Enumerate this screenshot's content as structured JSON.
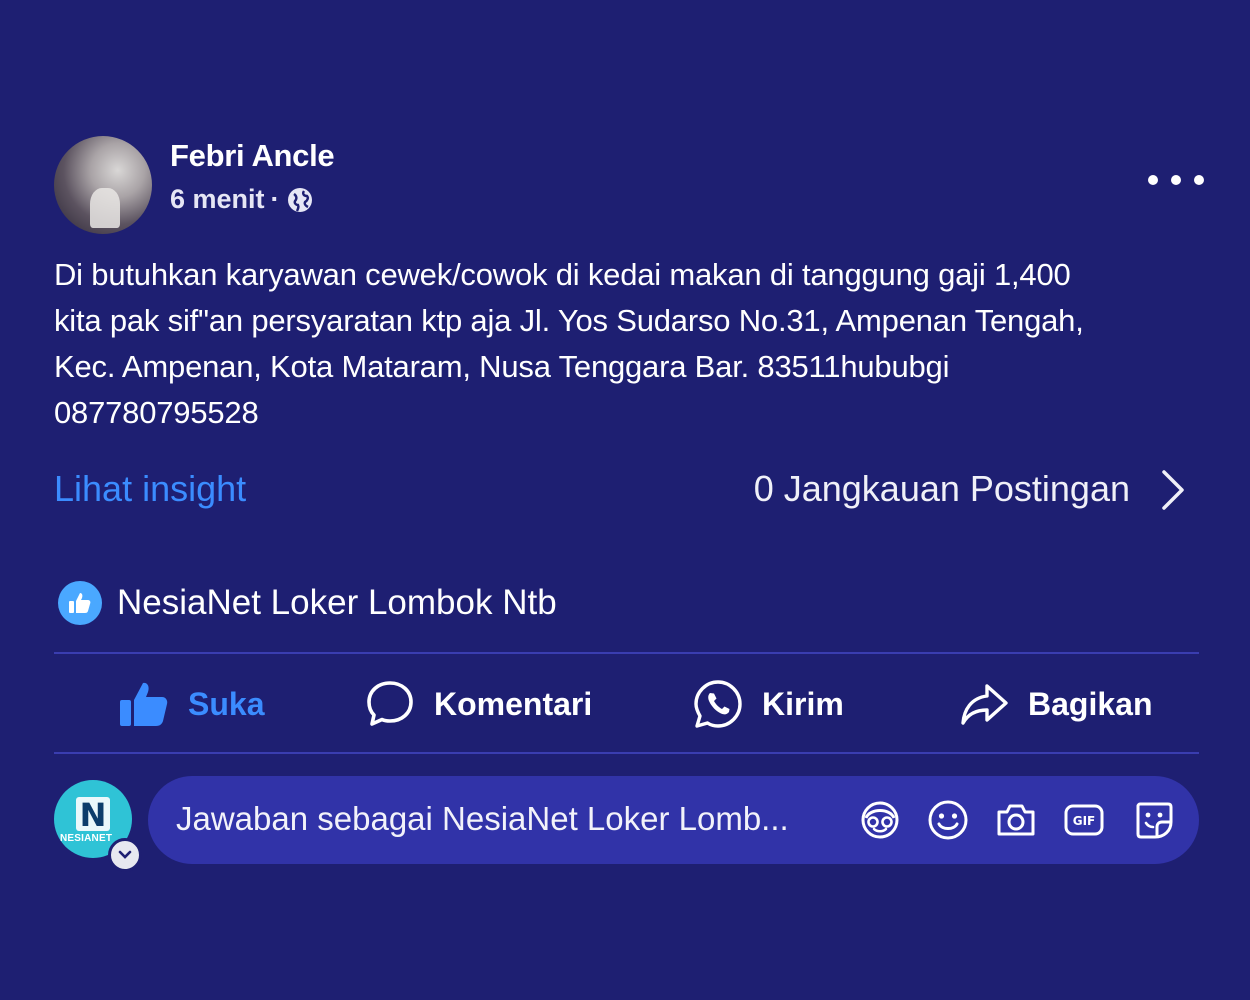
{
  "post": {
    "author": "Febri Ancle",
    "time": "6 menit",
    "separator": "·",
    "text_lines": [
      "Di butuhkan karyawan cewek/cowok di kedai makan di tanggung gaji 1,400",
      "kita pak sif\"an persyaratan ktp aja Jl. Yos Sudarso No.31, Ampenan Tengah,",
      "Kec. Ampenan, Kota Mataram, Nusa Tenggara Bar. 83511hububgi",
      "087780795528"
    ]
  },
  "insight": {
    "link_label": "Lihat insight",
    "reach_label": "0 Jangkauan Postingan"
  },
  "reactions": {
    "reactor_name": "NesiaNet Loker Lombok Ntb"
  },
  "actions": {
    "like": "Suka",
    "comment": "Komentari",
    "send": "Kirim",
    "share": "Bagikan"
  },
  "composer": {
    "placeholder": "Jawaban sebagai NesiaNet Loker Lomb...",
    "page_logo_letter": "N",
    "page_logo_text": "NESIANET"
  },
  "icons": {
    "globe": "globe-icon",
    "more": "more-options-icon",
    "chevron": "chevron-right-icon",
    "like": "thumbs-up-icon",
    "comment": "comment-bubble-icon",
    "send": "whatsapp-icon",
    "share": "share-arrow-icon",
    "avatar_sticker": "avatar-sticker-icon",
    "emoji": "emoji-icon",
    "camera": "camera-icon",
    "gif": "gif-icon",
    "sticker": "sticker-icon"
  },
  "colors": {
    "background": "#1e1f72",
    "accent_blue": "#3b8cff",
    "input_background": "#3133a8"
  }
}
